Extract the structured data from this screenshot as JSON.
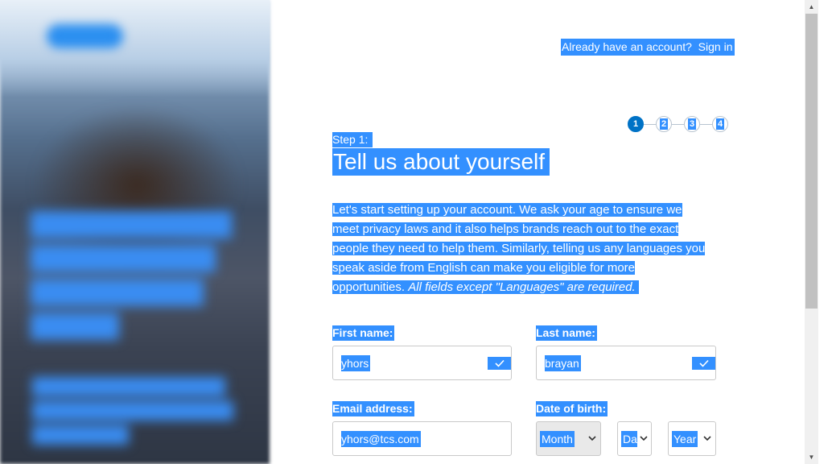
{
  "header": {
    "signin_prompt": "Already have an account?",
    "signin_link": "Sign in"
  },
  "steps": [
    "1",
    "2",
    "3",
    "4"
  ],
  "current_step": 1,
  "step_label": "Step 1:",
  "title": "Tell us about yourself",
  "intro": {
    "lines": [
      "Let's start setting up your account. We ask your age to ensure we",
      "meet privacy laws and it also helps brands reach out to the exact",
      "people they need to help them. Similarly, telling us any languages you",
      "speak aside from English can make you eligible for more",
      "opportunities."
    ],
    "emphasis": "All fields except \"Languages\" are required."
  },
  "form": {
    "first_name_label": "First name:",
    "first_name_value": "yhors",
    "last_name_label": "Last name:",
    "last_name_value": "brayan",
    "email_label": "Email address:",
    "email_value": "yhors@tcs.com",
    "dob_label": "Date of birth:",
    "month_value": "Month",
    "day_value": "Day",
    "year_value": "Year"
  },
  "colors": {
    "selection": "#3390ff",
    "brand_blue": "#0072c6"
  },
  "icons": {
    "check": "check-icon",
    "chevron": "chevron-down-icon"
  }
}
